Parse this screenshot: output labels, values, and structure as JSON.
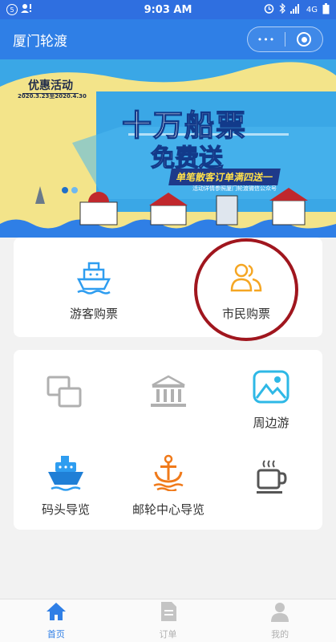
{
  "status_bar": {
    "time": "9:03 AM",
    "left_badge": "5",
    "network": "4G"
  },
  "app_bar": {
    "title": "厦门轮渡",
    "menu_glyph": "•••"
  },
  "banner": {
    "promo_label": "优惠活动",
    "promo_date": "2020.3.23至2020.4.30",
    "headline": "十万船票",
    "subhead": "免费送",
    "tagline": "单笔散客订单满四送一",
    "note": "活动详情参照厦门轮渡微信公众号"
  },
  "ticket_tiles": [
    {
      "label": "游客购票",
      "icon": "ship-icon"
    },
    {
      "label": "市民购票",
      "icon": "people-icon"
    }
  ],
  "service_tiles": [
    {
      "label": "",
      "icon": "windows-icon"
    },
    {
      "label": "",
      "icon": "bank-icon"
    },
    {
      "label": "周边游",
      "icon": "mountain-icon"
    },
    {
      "label": "码头导览",
      "icon": "cruise-ship-icon"
    },
    {
      "label": "邮轮中心导览",
      "icon": "anchor-icon"
    },
    {
      "label": "",
      "icon": "coffee-icon"
    }
  ],
  "tabs": [
    {
      "label": "首页",
      "icon": "home-icon",
      "active": true
    },
    {
      "label": "订单",
      "icon": "document-icon",
      "active": false
    },
    {
      "label": "我的",
      "icon": "user-icon",
      "active": false
    }
  ],
  "colors": {
    "brand": "#2f7fe6",
    "ticket_icon": "#2e9df0",
    "citizen_icon": "#f5a623",
    "highlight": "#a0161e",
    "tab_inactive": "#b0b0b0"
  }
}
